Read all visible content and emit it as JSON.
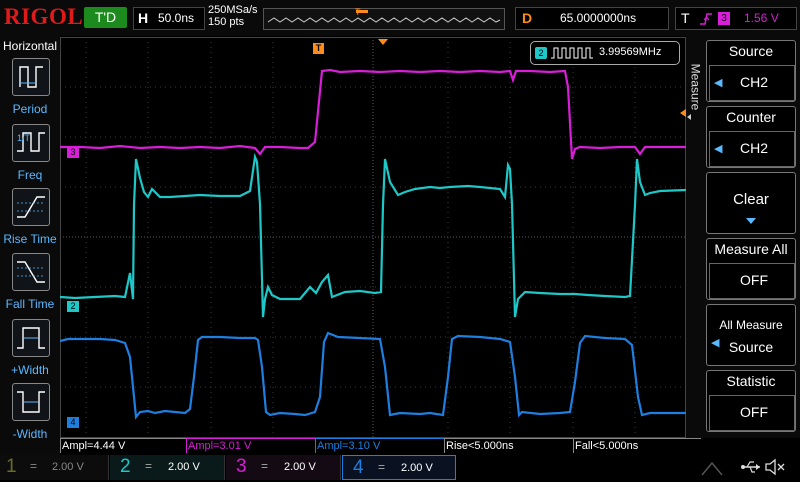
{
  "header": {
    "brand": "RIGOL",
    "run_state": "T'D",
    "horizontal": {
      "label": "H",
      "value": "50.0ns"
    },
    "sample_rate": "250MSa/s",
    "points": "150 pts",
    "delay": {
      "label": "D",
      "value": "65.0000000ns"
    },
    "trigger": {
      "label": "T",
      "source": "3",
      "level": "1.56 V"
    }
  },
  "left_menu": {
    "title": "Horizontal",
    "items": [
      {
        "label": "Period"
      },
      {
        "label": "Freq"
      },
      {
        "label": "Rise Time"
      },
      {
        "label": "Fall Time"
      },
      {
        "label": "+Width"
      },
      {
        "label": "-Width"
      }
    ]
  },
  "counter_readout": {
    "channel": "2",
    "value": "3.99569MHz"
  },
  "channel_markers": {
    "ch3": "3",
    "ch2": "2",
    "ch4": "4"
  },
  "right_menu": {
    "side_label": "Measure",
    "source": {
      "title": "Source",
      "value": "CH2"
    },
    "counter": {
      "title": "Counter",
      "value": "CH2"
    },
    "clear": {
      "title": "Clear"
    },
    "measure_all": {
      "title": "Measure All",
      "value": "OFF"
    },
    "all_measure_source": {
      "title": "All Measure",
      "value": "Source"
    },
    "statistic": {
      "title": "Statistic",
      "value": "OFF"
    }
  },
  "measurements": [
    {
      "text": "Ampl=4.44 V",
      "color": "#ffffff"
    },
    {
      "text": "Ampl=3.01 V",
      "color": "#d81ed8"
    },
    {
      "text": "Ampl=3.10 V",
      "color": "#1e7fe0"
    },
    {
      "text": "Rise<5.000ns",
      "color": "#ffffff"
    },
    {
      "text": "Fall<5.000ns",
      "color": "#ffffff"
    }
  ],
  "channels": [
    {
      "num": "1",
      "scale": "2.00 V",
      "color": "#e8e800"
    },
    {
      "num": "2",
      "scale": "2.00 V",
      "color": "#1fc8c8"
    },
    {
      "num": "3",
      "scale": "2.00 V",
      "color": "#d81ed8"
    },
    {
      "num": "4",
      "scale": "2.00 V",
      "color": "#1e7fe0"
    }
  ],
  "colors": {
    "ch1": "#e8e800",
    "ch2": "#1fc8c8",
    "ch3": "#d81ed8",
    "ch4": "#1e7fe0",
    "trigger": "#ff8c1a",
    "menu_accent": "#5ab8ff"
  },
  "icons": [
    "usb-icon",
    "speaker-mute-icon",
    "trigger-edge-icon"
  ]
}
